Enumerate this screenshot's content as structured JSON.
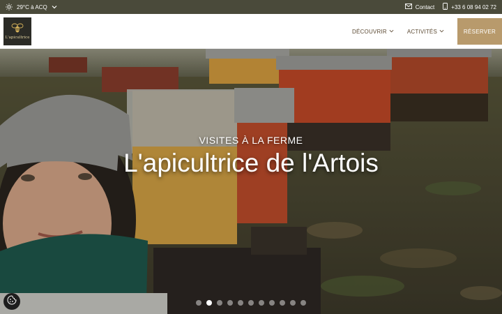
{
  "topbar": {
    "weather": "29°C à ACQ",
    "contact": "Contact",
    "phone": "+33 6 08 94 02 72"
  },
  "header": {
    "logo_text": "L'apicultrice",
    "nav": [
      {
        "label": "DÉCOUVRIR"
      },
      {
        "label": "ACTIVITÉS"
      }
    ],
    "reserve_label": "RÉSERVER"
  },
  "hero": {
    "subtitle": "VISITES À LA FERME",
    "title": "L'apicultrice de l'Artois",
    "slides_count": 11,
    "active_slide": 2
  },
  "colors": {
    "topbar": "#4a4a3a",
    "nav_text": "#5c4a33",
    "reserve_button": "#b89a6c"
  },
  "icons": {
    "weather": "sun-icon",
    "contact": "mail-icon",
    "phone": "phone-icon",
    "cookie": "cookie-icon"
  }
}
